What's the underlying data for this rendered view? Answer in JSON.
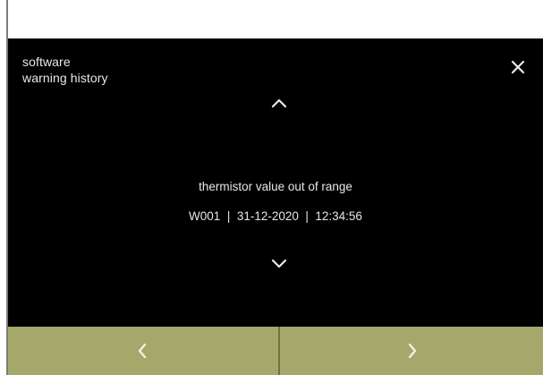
{
  "header": {
    "title_line1": "software",
    "title_line2": "warning history"
  },
  "icons": {
    "close": "close-icon",
    "up": "chevron-up-icon",
    "down": "chevron-down-icon",
    "prev": "chevron-left-icon",
    "next": "chevron-right-icon"
  },
  "warning": {
    "message": "thermistor value out of range",
    "meta": "W001  |  31-12-2020  |  12:34:56"
  },
  "colors": {
    "screen_bg": "#000000",
    "text": "#e6e6e6",
    "nav_bg": "#a4a86b",
    "nav_divider": "#6f7340"
  }
}
